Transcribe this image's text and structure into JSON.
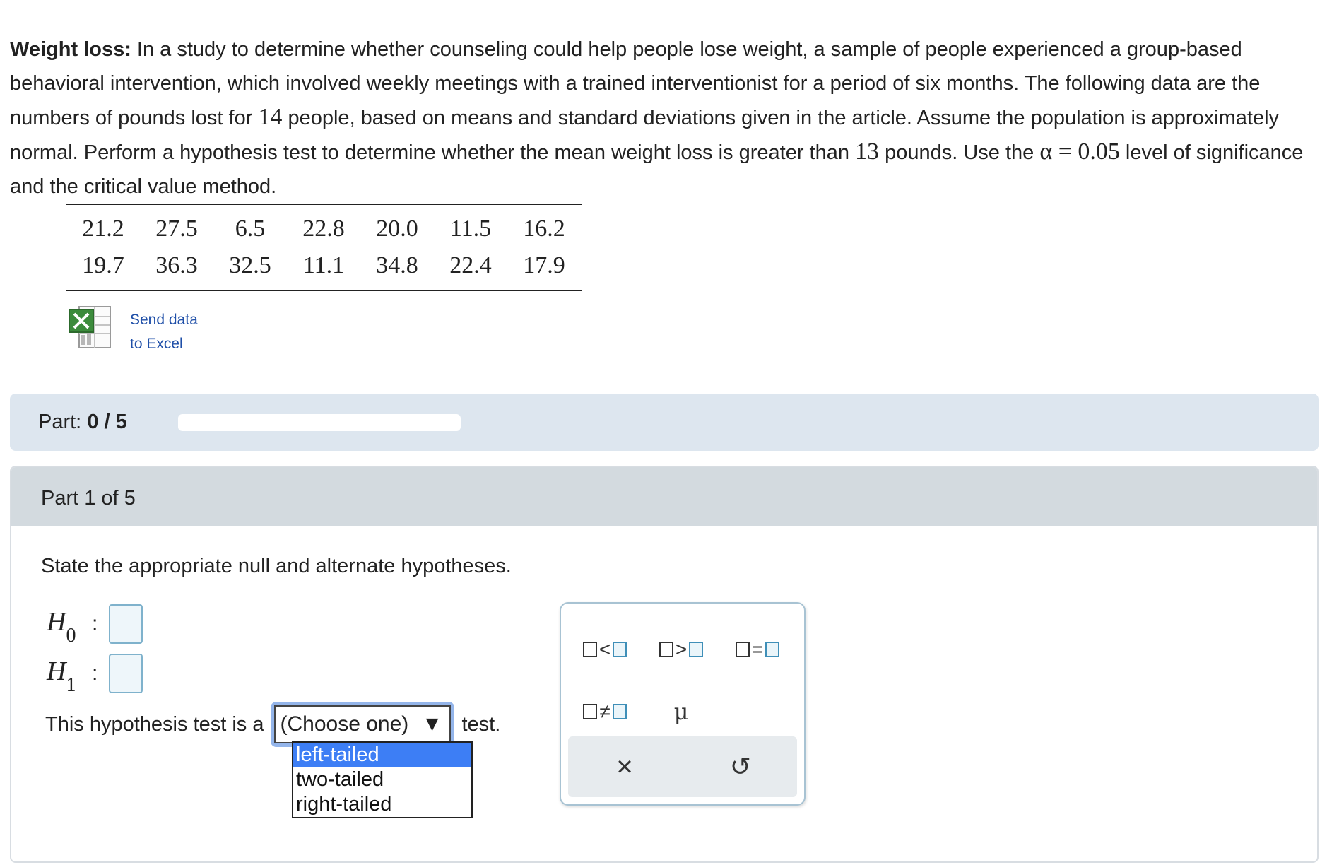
{
  "problem": {
    "title": "Weight loss:",
    "text1": " In a study to determine whether counseling could help people lose weight, a sample of people experienced a group-based behavioral intervention, which involved weekly meetings with a trained interventionist for a period of six months. The following data are the numbers of pounds lost for ",
    "n": "14",
    "text2": " people, based on means and standard deviations given in the article. Assume the population is approximately normal. Perform a hypothesis test to determine whether the mean weight loss is greater than ",
    "mu0": "13",
    "text3": " pounds. Use the ",
    "alpha": "α = 0.05",
    "text4": " level of significance and the critical value method."
  },
  "data_table": {
    "rows": [
      [
        "21.2",
        "27.5",
        "6.5",
        "22.8",
        "20.0",
        "11.5",
        "16.2"
      ],
      [
        "19.7",
        "36.3",
        "32.5",
        "11.1",
        "34.8",
        "22.4",
        "17.9"
      ]
    ]
  },
  "excel": {
    "line1": "Send data",
    "line2": "to Excel",
    "icon": "excel-spreadsheet-icon"
  },
  "progress": {
    "label": "Part:",
    "value": "0 / 5",
    "fraction": 0
  },
  "part": {
    "header": "Part 1 of 5",
    "instruction": "State the appropriate null and alternate hypotheses.",
    "h0": {
      "symbol": "H",
      "sub": "0",
      "colon": ":"
    },
    "h1": {
      "symbol": "H",
      "sub": "1",
      "colon": ":"
    },
    "sentence_prefix": "This hypothesis test is a",
    "select_value": "(Choose one)",
    "select_arrow": "▼",
    "sentence_suffix": "test.",
    "options": [
      "left-tailed",
      "two-tailed",
      "right-tailed"
    ]
  },
  "palette": {
    "less_than": "<",
    "greater_than": ">",
    "equals": "=",
    "not_equal": "≠",
    "mu": "μ",
    "clear": "×",
    "undo": "↺"
  }
}
